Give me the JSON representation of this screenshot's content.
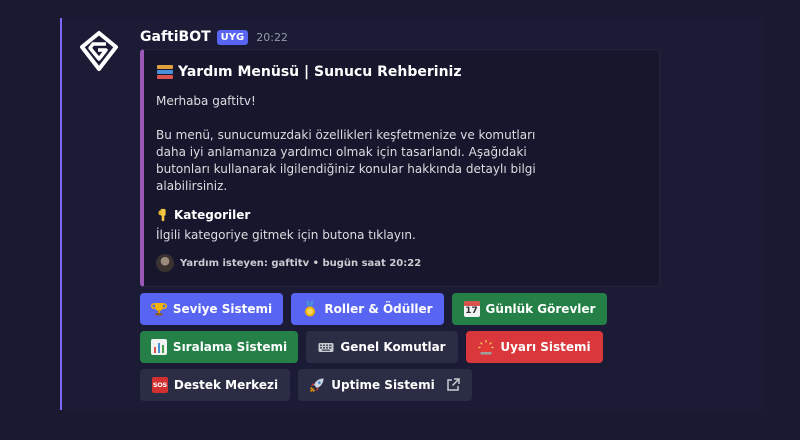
{
  "message": {
    "author": "GaftiBOT",
    "tag": "UYG",
    "time": "20:22"
  },
  "embed": {
    "title": "Yardım Menüsü | Sunucu Rehberiniz",
    "description": "Merhaba gaftitv!\n\nBu menü, sunucumuzdaki özellikleri keşfetmenize ve komutları daha iyi anlamanıza yardımcı olmak için tasarlandı. Aşağıdaki butonları kullanarak ilgilendiğiniz konular hakkında detaylı bilgi alabilirsiniz.",
    "field_name": "Kategoriler",
    "field_value": "İlgili kategoriye gitmek için butona tıklayın.",
    "footer": "Yardım isteyen: gaftitv • bugün saat 20:22",
    "accent_color": "#9b59b6"
  },
  "buttons": {
    "seviye": "Seviye Sistemi",
    "roller": "Roller & Ödüller",
    "gunluk": "Günlük Görevler",
    "siralama": "Sıralama Sistemi",
    "genel": "Genel Komutlar",
    "uyari": "Uyarı Sistemi",
    "destek": "Destek Merkezi",
    "uptime": "Uptime Sistemi",
    "calendar_day": "17",
    "sos": "SOS"
  },
  "icons": [
    "books-emoji",
    "trophy-emoji",
    "medal-emoji",
    "calendar-emoji",
    "bar-chart-emoji",
    "keyboard-emoji",
    "siren-emoji",
    "sos-emoji",
    "rocket-emoji",
    "external-link-icon",
    "point-down-emoji"
  ]
}
